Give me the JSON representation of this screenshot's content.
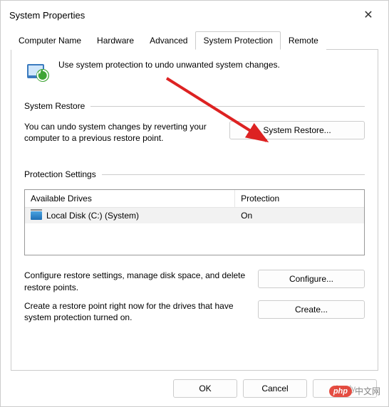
{
  "window": {
    "title": "System Properties",
    "close_symbol": "✕"
  },
  "tabs": [
    {
      "label": "Computer Name",
      "active": false
    },
    {
      "label": "Hardware",
      "active": false
    },
    {
      "label": "Advanced",
      "active": false
    },
    {
      "label": "System Protection",
      "active": true
    },
    {
      "label": "Remote",
      "active": false
    }
  ],
  "intro_text": "Use system protection to undo unwanted system changes.",
  "restore": {
    "title": "System Restore",
    "desc": "You can undo system changes by reverting your computer to a previous restore point.",
    "button": "System Restore..."
  },
  "protection": {
    "title": "Protection Settings",
    "columns": {
      "drives": "Available Drives",
      "protection": "Protection"
    },
    "rows": [
      {
        "name": "Local Disk (C:) (System)",
        "protection": "On"
      }
    ],
    "configure_desc": "Configure restore settings, manage disk space, and delete restore points.",
    "configure_button": "Configure...",
    "create_desc": "Create a restore point right now for the drives that have system protection turned on.",
    "create_button": "Create..."
  },
  "footer": {
    "ok": "OK",
    "cancel": "Cancel",
    "apply": "Apply"
  },
  "watermark": {
    "bubble": "php",
    "text": "中文网"
  }
}
